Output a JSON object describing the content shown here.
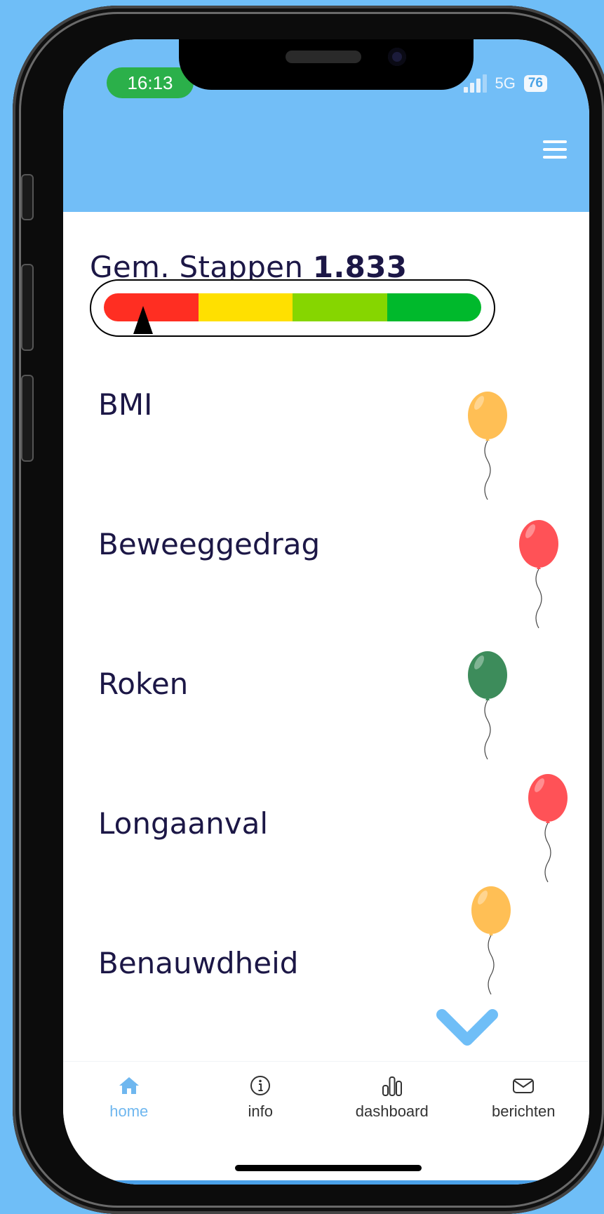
{
  "status_bar": {
    "time": "16:13",
    "network": "5G",
    "battery": "76"
  },
  "steps": {
    "label": "Gem. Stappen",
    "value": "1.833",
    "gauge_colors": [
      "#ff2e22",
      "#ffe000",
      "#86d600",
      "#00b92c"
    ],
    "marker_level": 0.105
  },
  "categories": [
    {
      "label": "BMI",
      "balloon_color": "#ffbf55"
    },
    {
      "label": "Beweeggedrag",
      "balloon_color": "#ff5257"
    },
    {
      "label": "Roken",
      "balloon_color": "#3d8c5b"
    },
    {
      "label": "Longaanval",
      "balloon_color": "#ff5257"
    },
    {
      "label": "Benauwdheid",
      "balloon_color": "#ffbf55"
    }
  ],
  "nav": [
    {
      "label": "home",
      "icon": "home-icon",
      "active": true
    },
    {
      "label": "info",
      "icon": "info-icon",
      "active": false
    },
    {
      "label": "dashboard",
      "icon": "bar-chart-icon",
      "active": false
    },
    {
      "label": "berichten",
      "icon": "envelope-icon",
      "active": false
    }
  ],
  "colors": {
    "brand_blue": "#72bef7",
    "accent_blue": "#6fb7ef",
    "text": "#1c1746"
  }
}
